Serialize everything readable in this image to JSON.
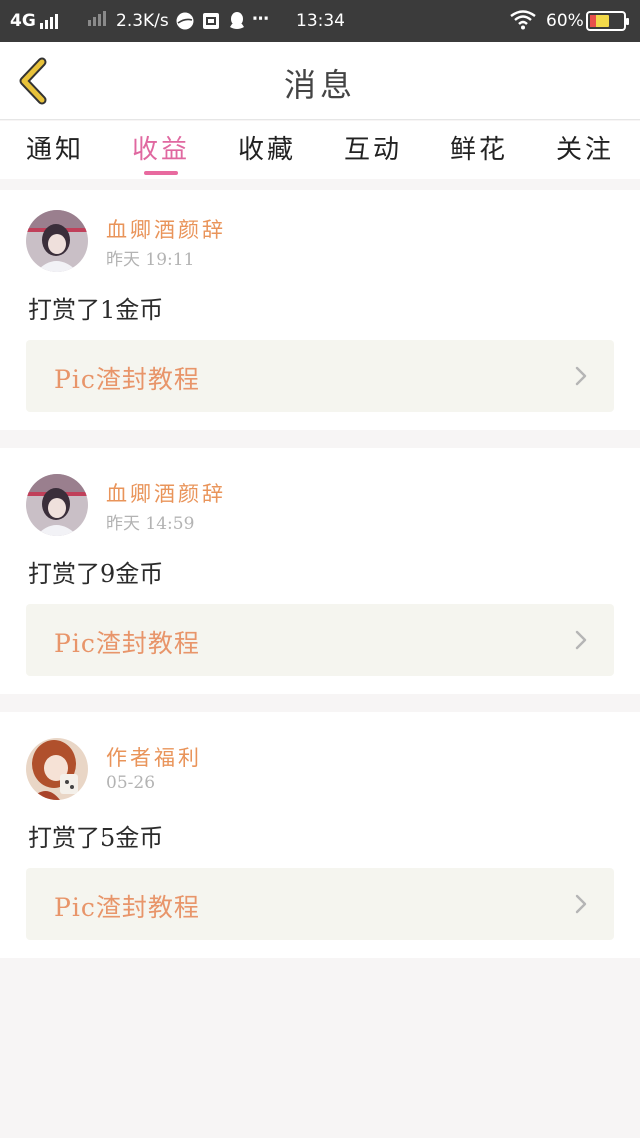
{
  "status_bar": {
    "network": "4G",
    "speed": "2.3K/s",
    "time": "13:34",
    "battery": "60%",
    "battery_level": 0.6,
    "icons": [
      "signal-icon",
      "signal-icon",
      "globe-icon",
      "photo-icon",
      "qq-icon",
      "more-icon",
      "wifi-icon",
      "battery-icon"
    ]
  },
  "header": {
    "title": "消息",
    "back_icon": "chevron-left-icon"
  },
  "tabs": [
    {
      "label": "通知"
    },
    {
      "label": "收益"
    },
    {
      "label": "收藏"
    },
    {
      "label": "互动"
    },
    {
      "label": "鲜花"
    },
    {
      "label": "关注"
    }
  ],
  "active_tab": "收益",
  "messages": [
    {
      "sender": "血卿酒颜辞",
      "time": "昨天 19:11",
      "content": "打赏了1金币",
      "link_title": "Pic渣封教程"
    },
    {
      "sender": "血卿酒颜辞",
      "time": "昨天 14:59",
      "content": "打赏了9金币",
      "link_title": "Pic渣封教程"
    },
    {
      "sender": "作者福利",
      "time": "05-26",
      "content": "打赏了5金币",
      "link_title": "Pic渣封教程"
    }
  ],
  "colors": {
    "accent_pink": "#e068a0",
    "sender_orange": "#e9945a",
    "link_orange": "#e8956a",
    "link_bg": "#f5f5ef",
    "page_bg": "#f7f5f5",
    "back_icon": "#e8c23a"
  }
}
